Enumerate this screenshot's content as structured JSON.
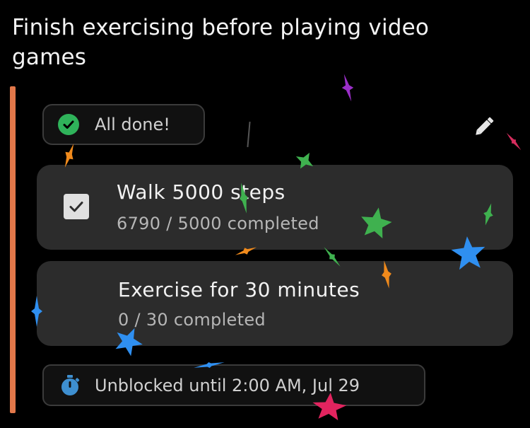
{
  "goal": {
    "title": "Finish exercising before playing video games"
  },
  "status": {
    "label": "All done!",
    "icon": "check-circle-icon",
    "color": "#2fb35a"
  },
  "edit": {
    "icon": "pencil-icon"
  },
  "tasks": [
    {
      "title": "Walk 5000 steps",
      "progress_text": "6790 / 5000 completed",
      "current": 6790,
      "target": 5000,
      "checked": true
    },
    {
      "title": "Exercise for 30 minutes",
      "progress_text": "0 / 30 completed",
      "current": 0,
      "target": 30,
      "checked": false
    }
  ],
  "unblock": {
    "label": "Unblocked until 2:00 AM, Jul 29",
    "icon": "stopwatch-icon",
    "icon_color": "#3e8fd0"
  },
  "colors": {
    "accent": "#e2784a",
    "card": "#2c2c2c",
    "background": "#000000"
  }
}
